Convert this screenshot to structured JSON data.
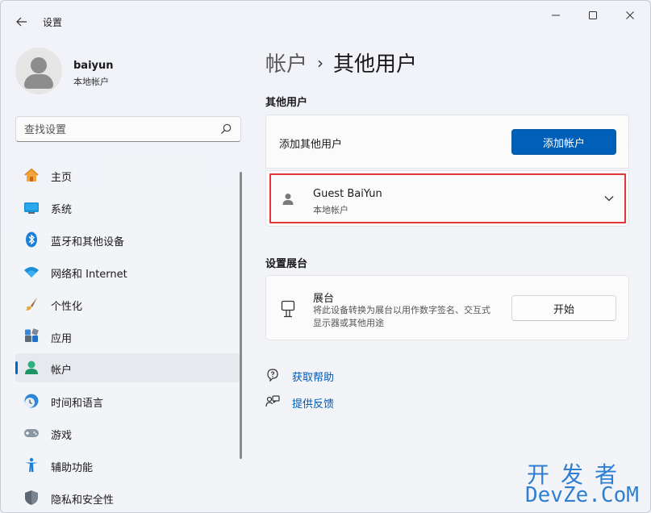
{
  "window": {
    "title": "设置",
    "back_icon": "arrow-left-icon",
    "controls": [
      "minimize-icon",
      "maximize-icon",
      "close-icon"
    ]
  },
  "profile": {
    "name": "baiyun",
    "account_type": "本地帐户"
  },
  "search": {
    "placeholder": "查找设置",
    "icon": "search-icon"
  },
  "sidebar": {
    "items": [
      {
        "label": "主页",
        "icon": "home-icon",
        "selected": false
      },
      {
        "label": "系统",
        "icon": "monitor-icon",
        "selected": false
      },
      {
        "label": "蓝牙和其他设备",
        "icon": "bluetooth-icon",
        "selected": false
      },
      {
        "label": "网络和 Internet",
        "icon": "wifi-icon",
        "selected": false
      },
      {
        "label": "个性化",
        "icon": "brush-icon",
        "selected": false
      },
      {
        "label": "应用",
        "icon": "apps-icon",
        "selected": false
      },
      {
        "label": "帐户",
        "icon": "person-icon",
        "selected": true
      },
      {
        "label": "时间和语言",
        "icon": "clock-globe-icon",
        "selected": false
      },
      {
        "label": "游戏",
        "icon": "gamepad-icon",
        "selected": false
      },
      {
        "label": "辅助功能",
        "icon": "accessibility-icon",
        "selected": false
      },
      {
        "label": "隐私和安全性",
        "icon": "shield-icon",
        "selected": false
      }
    ]
  },
  "breadcrumb": {
    "parent": "帐户",
    "separator": "›",
    "current": "其他用户"
  },
  "other_users": {
    "section_title": "其他用户",
    "add_label": "添加其他用户",
    "add_button": "添加帐户",
    "user": {
      "name": "Guest BaiYun",
      "type": "本地帐户",
      "icon": "person-icon",
      "expand_icon": "chevron-down-icon"
    }
  },
  "kiosk": {
    "section_title": "设置展台",
    "title": "展台",
    "description": "将此设备转换为展台以用作数字签名、交互式显示器或其他用途",
    "button": "开始",
    "icon": "kiosk-icon"
  },
  "links": [
    {
      "label": "获取帮助",
      "icon": "help-icon"
    },
    {
      "label": "提供反馈",
      "icon": "feedback-icon"
    }
  ],
  "watermark": {
    "top": "开发者",
    "bottom": "DevZe.CoM"
  },
  "colors": {
    "accent": "#005fb8",
    "highlight_border": "#e0373a",
    "link": "#0058b3"
  }
}
